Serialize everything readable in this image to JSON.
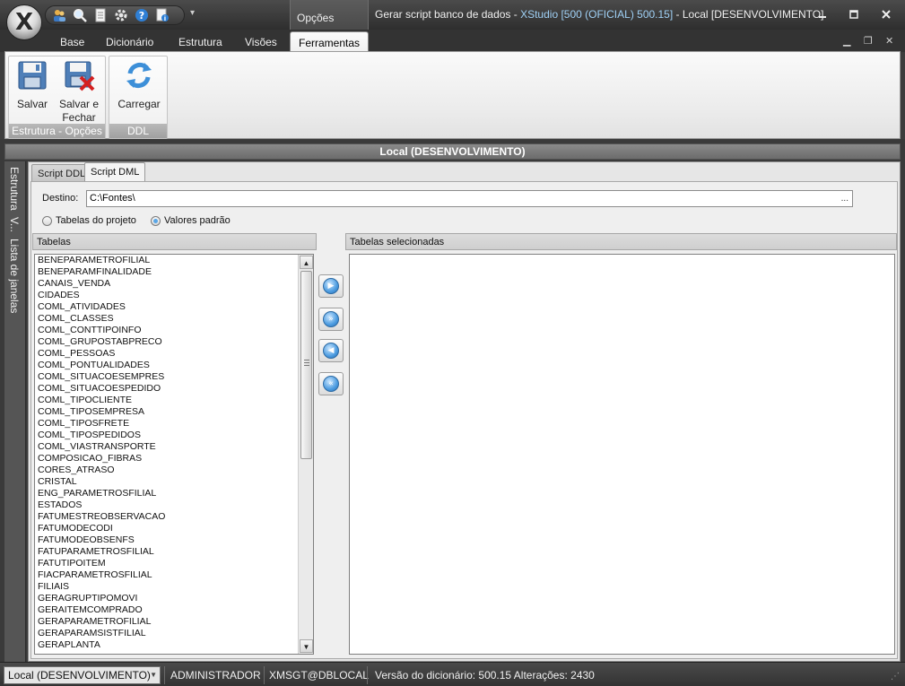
{
  "app": {
    "title_prefix": "Gerar script banco de dados - ",
    "title_highlight": "XStudio [500 (OFICIAL) 500.15]",
    "title_suffix": " - Local [DESENVOLVIMENTO]",
    "context_tab": "Opções",
    "qat_icons": [
      "users-icon",
      "search-icon",
      "document-icon",
      "gear-icon",
      "help-icon",
      "info-icon"
    ]
  },
  "ribbon": {
    "tabs": [
      "Base",
      "Dicionário",
      "Estrutura",
      "Visões",
      "Ferramentas"
    ],
    "active_tab": "Ferramentas",
    "groups": [
      {
        "caption": "Estrutura - Opções",
        "buttons": [
          {
            "label": "Salvar",
            "icon": "save-icon"
          },
          {
            "label": "Salvar e Fechar",
            "icon": "save-close-icon"
          }
        ]
      },
      {
        "caption": "DDL",
        "buttons": [
          {
            "label": "Carregar",
            "icon": "refresh-icon"
          }
        ]
      }
    ]
  },
  "document": {
    "header": "Local (DESENVOLVIMENTO)",
    "side_tabs": [
      "Estrutura",
      "V...",
      "Lista de janelas"
    ],
    "tabs": [
      "Script DDL",
      "Script DML"
    ],
    "active_tab": "Script DML",
    "destino_label": "Destino:",
    "destino_value": "C:\\Fontes\\",
    "destino_button": "...",
    "radio_options": [
      {
        "label": "Tabelas do projeto",
        "checked": false
      },
      {
        "label": "Valores padrão",
        "checked": true
      }
    ],
    "tables_header": "Tabelas",
    "selected_header": "Tabelas selecionadas",
    "tables": [
      "BENEPARAMETROFILIAL",
      "BENEPARAMFINALIDADE",
      "CANAIS_VENDA",
      "CIDADES",
      "COML_ATIVIDADES",
      "COML_CLASSES",
      "COML_CONTTIPOINFO",
      "COML_GRUPOSTABPRECO",
      "COML_PESSOAS",
      "COML_PONTUALIDADES",
      "COML_SITUACOESEMPRES",
      "COML_SITUACOESPEDIDO",
      "COML_TIPOCLIENTE",
      "COML_TIPOSEMPRESA",
      "COML_TIPOSFRETE",
      "COML_TIPOSPEDIDOS",
      "COML_VIASTRANSPORTE",
      "COMPOSICAO_FIBRAS",
      "CORES_ATRASO",
      "CRISTAL",
      "ENG_PARAMETROSFILIAL",
      "ESTADOS",
      "FATUMESTREOBSERVACAO",
      "FATUMODECODI",
      "FATUMODEOBSENFS",
      "FATUPARAMETROSFILIAL",
      "FATUTIPOITEM",
      "FIACPARAMETROSFILIAL",
      "FILIAIS",
      "GERAGRUPTIPOMOVI",
      "GERAITEMCOMPRADO",
      "GERAPARAMETROFILIAL",
      "GERAPARAMSISTFILIAL",
      "GERAPLANTA"
    ],
    "selected_tables": [],
    "move_buttons": [
      {
        "name": "add-one",
        "glyph": "▶"
      },
      {
        "name": "add-all",
        "glyph": "»"
      },
      {
        "name": "remove-one",
        "glyph": "◀"
      },
      {
        "name": "remove-all",
        "glyph": "«"
      }
    ]
  },
  "status": {
    "connection": "Local (DESENVOLVIMENTO)",
    "user": "ADMINISTRADOR",
    "database": "XMSGT@DBLOCAL",
    "version": "Versão do dicionário: 500.15 Alterações: 2430"
  }
}
